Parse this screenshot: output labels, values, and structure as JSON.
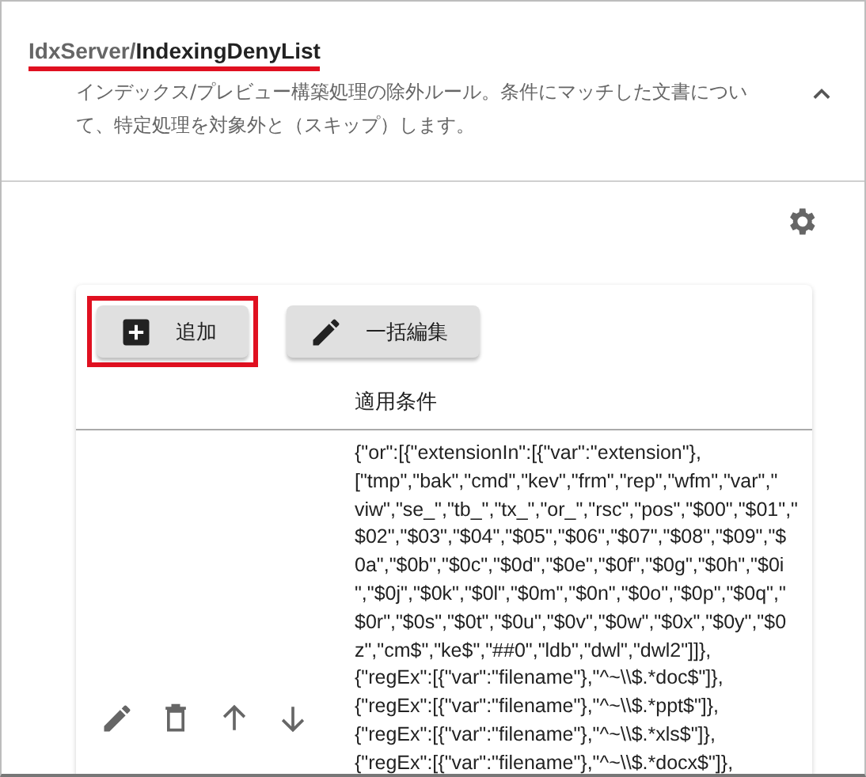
{
  "header": {
    "path_prefix": "IdxServer/",
    "path_name": "IndexingDenyList",
    "description": "インデックス/プレビュー構築処理の除外ルール。条件にマッチした文書について、特定処理を対象外と（スキップ）します。",
    "expanded": true
  },
  "toolbar": {
    "buttons": [
      {
        "label": "追加",
        "kind": "add",
        "highlighted": true
      },
      {
        "label": "一括編集",
        "kind": "edit",
        "highlighted": false
      }
    ]
  },
  "table": {
    "columns": [
      "適用条件"
    ],
    "rows": [
      {
        "condition_lines": [
          "{\"or\":[{\"extensionIn\":[{\"var\":\"extension\"},",
          "[\"tmp\",\"bak\",\"cmd\",\"kev\",\"frm\",\"rep\",\"wfm\",\"var\",\"",
          "viw\",\"se_\",\"tb_\",\"tx_\",\"or_\",\"rsc\",\"pos\",\"$00\",\"$01\",\"",
          "$02\",\"$03\",\"$04\",\"$05\",\"$06\",\"$07\",\"$08\",\"$09\",\"$",
          "0a\",\"$0b\",\"$0c\",\"$0d\",\"$0e\",\"$0f\",\"$0g\",\"$0h\",\"$0i",
          "\",\"$0j\",\"$0k\",\"$0l\",\"$0m\",\"$0n\",\"$0o\",\"$0p\",\"$0q\",\"",
          "$0r\",\"$0s\",\"$0t\",\"$0u\",\"$0v\",\"$0w\",\"$0x\",\"$0y\",\"$0",
          "z\",\"cm$\",\"ke$\",\"##0\",\"ldb\",\"dwl\",\"dwl2\"]]},",
          "{\"regEx\":[{\"var\":\"filename\"},\"^~\\\\$.*doc$\"]},",
          "{\"regEx\":[{\"var\":\"filename\"},\"^~\\\\$.*ppt$\"]},",
          "{\"regEx\":[{\"var\":\"filename\"},\"^~\\\\$.*xls$\"]},",
          "{\"regEx\":[{\"var\":\"filename\"},\"^~\\\\$.*docx$\"]},"
        ]
      }
    ]
  }
}
